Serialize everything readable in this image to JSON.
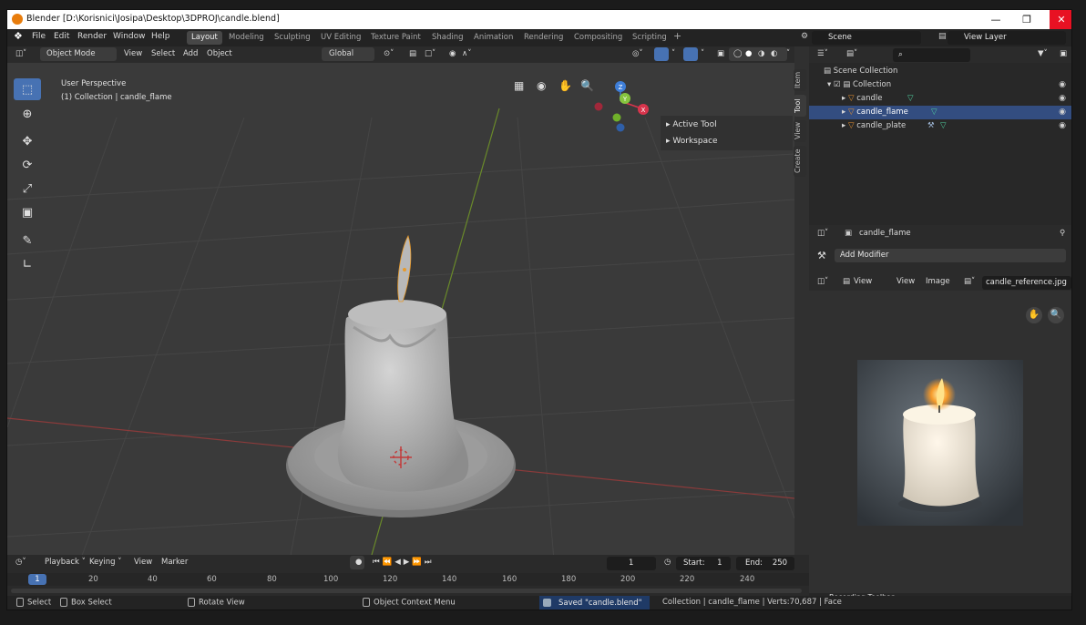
{
  "window": {
    "title": "Blender [D:\\Korisnici\\Josipa\\Desktop\\3DPROJ\\candle.blend]"
  },
  "menu": [
    "File",
    "Edit",
    "Render",
    "Window",
    "Help"
  ],
  "workspaces": [
    "Layout",
    "Modeling",
    "Sculpting",
    "UV Editing",
    "Texture Paint",
    "Shading",
    "Animation",
    "Rendering",
    "Compositing",
    "Scripting"
  ],
  "active_workspace": "Layout",
  "scene": {
    "name": "Scene",
    "view_layer": "View Layer"
  },
  "viewport": {
    "mode": "Object Mode",
    "header_menus": [
      "View",
      "Select",
      "Add",
      "Object"
    ],
    "orientation": "Global",
    "overlay_text_1": "User Perspective",
    "overlay_text_2": "(1) Collection | candle_flame",
    "n_panel": [
      "Active Tool",
      "Workspace"
    ],
    "n_tabs": [
      "Item",
      "Tool",
      "View",
      "Create"
    ],
    "gizmo": {
      "z": "Z",
      "y": "Y",
      "x": "X"
    }
  },
  "outliner": {
    "root": "Scene Collection",
    "collection": "Collection",
    "objects": [
      {
        "name": "candle",
        "selected": false
      },
      {
        "name": "candle_flame",
        "selected": true
      },
      {
        "name": "candle_plate",
        "selected": false
      }
    ]
  },
  "properties": {
    "object": "candle_flame",
    "add_modifier": "Add Modifier"
  },
  "image_editor": {
    "view": "View",
    "menus": [
      "View",
      "Image"
    ],
    "image_name": "candle_reference.jpg"
  },
  "timeline": {
    "menus": [
      "Playback",
      "Keying",
      "View",
      "Marker"
    ],
    "current_frame": "1",
    "start_label": "Start:",
    "start": "1",
    "end_label": "End:",
    "end": "250",
    "ticks": [
      "1",
      "20",
      "40",
      "60",
      "80",
      "100",
      "120",
      "140",
      "160",
      "180",
      "200",
      "220",
      "240"
    ]
  },
  "status": {
    "select": "Select",
    "box_select": "Box Select",
    "rotate_view": "Rotate View",
    "context_menu": "Object Context Menu",
    "saved": "Saved \"candle.blend\"",
    "stats": "Collection | candle_flame | Verts:70,687 | Face",
    "recording": "Recording Toolbar"
  },
  "colors": {
    "accent": "#4772b3",
    "selection_row": "#334d80",
    "close_red": "#e81123",
    "object_orange": "#e8912f",
    "mesh_green": "#4fd0a0"
  }
}
